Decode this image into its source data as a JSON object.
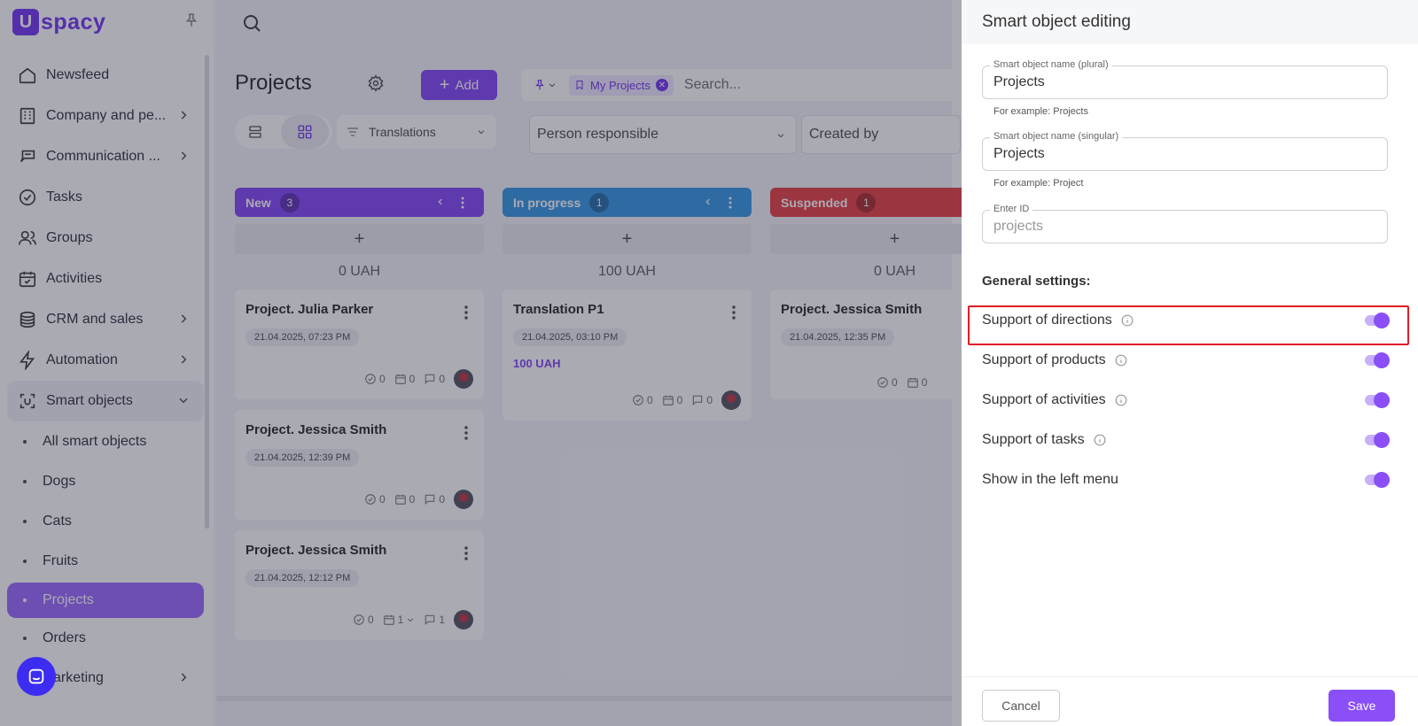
{
  "logo": {
    "text": "spacy",
    "mark": "U"
  },
  "sidebar": {
    "items": [
      {
        "label": "Newsfeed",
        "icon": "home-icon"
      },
      {
        "label": "Company and pe...",
        "icon": "building-icon",
        "has_children": true
      },
      {
        "label": "Communication ...",
        "icon": "chat-icon",
        "has_children": true
      },
      {
        "label": "Tasks",
        "icon": "check-circle-icon"
      },
      {
        "label": "Groups",
        "icon": "users-icon"
      },
      {
        "label": "Activities",
        "icon": "calendar-icon"
      },
      {
        "label": "CRM and sales",
        "icon": "coins-icon",
        "has_children": true
      },
      {
        "label": "Automation",
        "icon": "lightning-icon",
        "has_children": true
      },
      {
        "label": "Smart objects",
        "icon": "scan-icon",
        "expanded": true
      }
    ],
    "sub_items": [
      "All smart objects",
      "Dogs",
      "Cats",
      "Fruits",
      "Projects",
      "Orders"
    ],
    "active_sub": "Projects",
    "last_item": "arketing"
  },
  "main": {
    "title": "Projects",
    "add_label": "Add",
    "filter_chip": "My Projects",
    "search_placeholder": "Search...",
    "pipeline": "Translations",
    "person_responsible": "Person responsible",
    "created_by": "Created by"
  },
  "columns": [
    {
      "name": "New",
      "count": "3",
      "color": "#8a4ff7",
      "sum": "0 UAH",
      "cards": [
        {
          "title": "Project. Julia Parker",
          "date": "21.04.2025, 07:23 PM",
          "tasks": "0",
          "activities": "0",
          "comments": "0"
        },
        {
          "title": "Project. Jessica Smith",
          "date": "21.04.2025, 12:39 PM",
          "tasks": "0",
          "activities": "0",
          "comments": "0"
        },
        {
          "title": "Project. Jessica Smith",
          "date": "21.04.2025, 12:12 PM",
          "tasks": "0",
          "activities": "1",
          "comments": "1"
        }
      ]
    },
    {
      "name": "In progress",
      "count": "1",
      "color": "#3f9de6",
      "sum": "100 UAH",
      "cards": [
        {
          "title": "Translation P1",
          "date": "21.04.2025, 03:10 PM",
          "amount": "100 UAH",
          "tasks": "0",
          "activities": "0",
          "comments": "0"
        }
      ]
    },
    {
      "name": "Suspended",
      "count": "1",
      "color": "#e8484b",
      "sum": "0 UAH",
      "cards": [
        {
          "title": "Project. Jessica Smith",
          "date": "21.04.2025, 12:35 PM",
          "tasks": "0",
          "activities": "0"
        }
      ]
    }
  ],
  "drawer": {
    "title": "Smart object editing",
    "plural_label": "Smart object name (plural)",
    "plural_value": "Projects",
    "plural_helper": "For example: Projects",
    "singular_label": "Smart object name (singular)",
    "singular_value": "Projects",
    "singular_helper": "For example: Project",
    "id_label": "Enter ID",
    "id_placeholder": "projects",
    "section_title": "General settings:",
    "settings": [
      {
        "label": "Support of directions",
        "info": true,
        "enabled": true
      },
      {
        "label": "Support of products",
        "info": true,
        "enabled": true
      },
      {
        "label": "Support of activities",
        "info": true,
        "enabled": true
      },
      {
        "label": "Support of tasks",
        "info": true,
        "enabled": true
      },
      {
        "label": "Show in the left menu",
        "info": false,
        "enabled": true
      }
    ],
    "cancel_label": "Cancel",
    "save_label": "Save"
  },
  "colors": {
    "accent": "#8a4ff7",
    "highlight": "#e11d2a"
  }
}
